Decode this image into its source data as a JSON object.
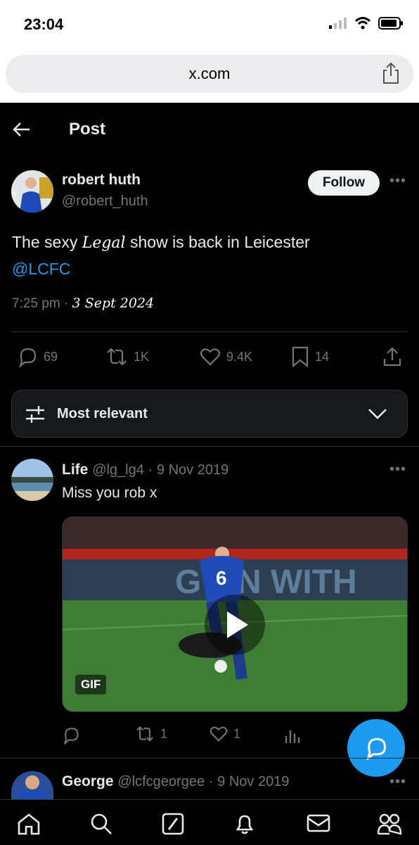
{
  "status_bar": {
    "time": "23:04"
  },
  "browser": {
    "url": "x.com"
  },
  "header": {
    "title": "Post"
  },
  "post": {
    "author_name": "robert huth",
    "author_handle": "@robert_huth",
    "follow_label": "Follow",
    "text_before": "The sexy ",
    "handwritten_word": "Legal",
    "text_after": " show is back in Leicester",
    "mention": "@LCFC",
    "time": "7:25 pm ·",
    "handwritten_date": "3 Sept 2024",
    "stats": {
      "replies": "69",
      "reposts": "1K",
      "likes": "9.4K",
      "bookmarks": "14"
    }
  },
  "sort": {
    "label": "Most relevant"
  },
  "replies": [
    {
      "name": "Life",
      "handle": "@lg_lg4",
      "date": "· 9 Nov 2019",
      "text": "Miss you rob x",
      "media_badge": "GIF",
      "stats": {
        "reposts": "1",
        "likes": "1"
      }
    },
    {
      "name": "George",
      "handle": "@lcfcgeorgee",
      "date": "· 9 Nov 2019"
    }
  ],
  "icons": {
    "back": "arrow-left-icon",
    "share": "share-icon",
    "more": "more-horizontal-icon",
    "reply": "reply-icon",
    "repost": "repost-icon",
    "like": "heart-icon",
    "bookmark": "bookmark-icon",
    "sliders": "sliders-icon",
    "chevron": "chevron-down-icon",
    "views": "analytics-icon",
    "compose": "compose-icon",
    "home": "home-icon",
    "search": "search-icon",
    "grok": "grok-icon",
    "notifications": "bell-icon",
    "messages": "mail-icon",
    "communities": "people-icon"
  },
  "colors": {
    "accent": "#1d9bf0",
    "background": "#000000",
    "muted": "#71767b",
    "text": "#e7e9ea"
  }
}
